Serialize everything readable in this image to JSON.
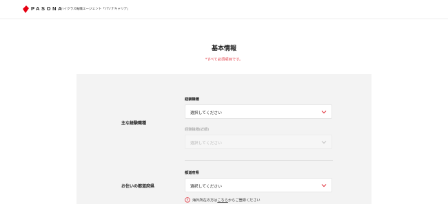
{
  "header": {
    "logo_text": "PASONA",
    "tagline": "ハイクラス転職エージェント「パソナキャリア」",
    "brand_color": "#e60012"
  },
  "page": {
    "title": "基本情報",
    "required_note": "*すべて必須項目です。"
  },
  "sections": {
    "experience": {
      "label": "主な経験職種",
      "job_type_label": "経験職種",
      "job_type_value": "選択してください",
      "job_detail_label": "経験職種(詳細)",
      "job_detail_value": "選択してください"
    },
    "residence": {
      "label": "お住いの都道府県",
      "prefecture_label": "都道府県",
      "prefecture_value": "選択してください",
      "notice_prefix": "海外所在の方は",
      "notice_link": "こちら",
      "notice_suffix": "からご登録ください"
    }
  },
  "colors": {
    "accent": "#e0303a",
    "panel_bg": "#f3f3f3"
  }
}
